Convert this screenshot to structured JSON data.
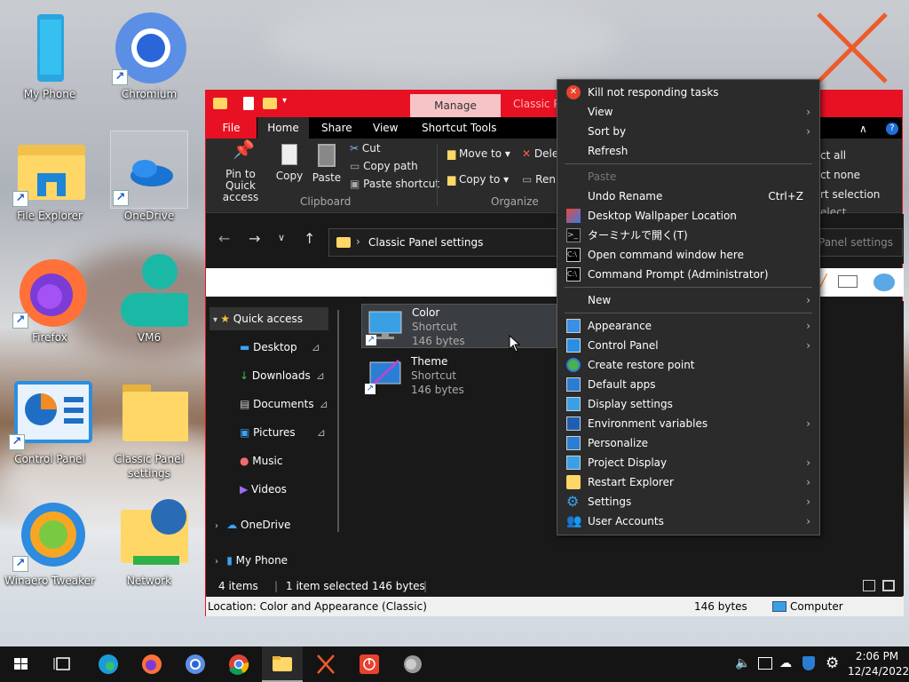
{
  "desktop": {
    "icons": [
      {
        "label": "My Phone"
      },
      {
        "label": "Chromium"
      },
      {
        "label": "File Explorer"
      },
      {
        "label": "OneDrive"
      },
      {
        "label": "Firefox"
      },
      {
        "label": "VM6"
      },
      {
        "label": "Control Panel"
      },
      {
        "label": "Classic Panel settings"
      },
      {
        "label": "Winaero Tweaker"
      },
      {
        "label": "Network"
      }
    ]
  },
  "window": {
    "manage_tab": "Manage",
    "title_partial": "Classic Pa",
    "tabs": [
      "File",
      "Home",
      "Share",
      "View",
      "Shortcut Tools"
    ],
    "ribbon": {
      "pin": "Pin to Quick access",
      "copy": "Copy",
      "paste": "Paste",
      "cut": "Cut",
      "copy_path": "Copy path",
      "paste_shortcut": "Paste shortcut",
      "move_to": "Move to",
      "copy_to": "Copy to",
      "delete": "Dele",
      "rename": "Ren",
      "select_all": "ct all",
      "select_none": "ct none",
      "invert": "rt selection",
      "group_clipboard": "Clipboard",
      "group_organize": "Organize",
      "group_select": "elect"
    },
    "address": "Classic Panel settings",
    "search_placeholder": "Panel settings",
    "nav": [
      {
        "label": "Quick access"
      },
      {
        "label": "Desktop"
      },
      {
        "label": "Downloads"
      },
      {
        "label": "Documents"
      },
      {
        "label": "Pictures"
      },
      {
        "label": "Music"
      },
      {
        "label": "Videos"
      },
      {
        "label": "OneDrive"
      },
      {
        "label": "My Phone"
      }
    ],
    "files": [
      {
        "name": "Color",
        "type": "Shortcut",
        "size": "146 bytes"
      },
      {
        "name": "Theme",
        "type": "Shortcut",
        "size": "146 bytes"
      }
    ],
    "status": {
      "items": "4 items",
      "selected": "1 item selected",
      "size": "146 bytes"
    },
    "location_bar": {
      "location": "Location: Color and Appearance (Classic)",
      "size": "146 bytes",
      "computer": "Computer"
    }
  },
  "context_menu": {
    "items": [
      {
        "label": "Kill not responding tasks"
      },
      {
        "label": "View"
      },
      {
        "label": "Sort by"
      },
      {
        "label": "Refresh"
      },
      {
        "label": "Paste"
      },
      {
        "label": "Undo Rename",
        "shortcut": "Ctrl+Z"
      },
      {
        "label": "Desktop Wallpaper Location"
      },
      {
        "label": "ターミナルで開く(T)"
      },
      {
        "label": "Open command window here"
      },
      {
        "label": "Command Prompt (Administrator)"
      },
      {
        "label": "New"
      },
      {
        "label": "Appearance"
      },
      {
        "label": "Control Panel"
      },
      {
        "label": "Create restore point"
      },
      {
        "label": "Default apps"
      },
      {
        "label": "Display settings"
      },
      {
        "label": "Environment variables"
      },
      {
        "label": "Personalize"
      },
      {
        "label": "Project Display"
      },
      {
        "label": "Restart Explorer"
      },
      {
        "label": "Settings"
      },
      {
        "label": "User Accounts"
      }
    ]
  },
  "taskbar": {
    "time": "2:06 PM",
    "date": "12/24/2022"
  },
  "colors": {
    "accent": "#e81123",
    "manage_tab": "#f7c4c6",
    "selected": "#3a3d41"
  }
}
